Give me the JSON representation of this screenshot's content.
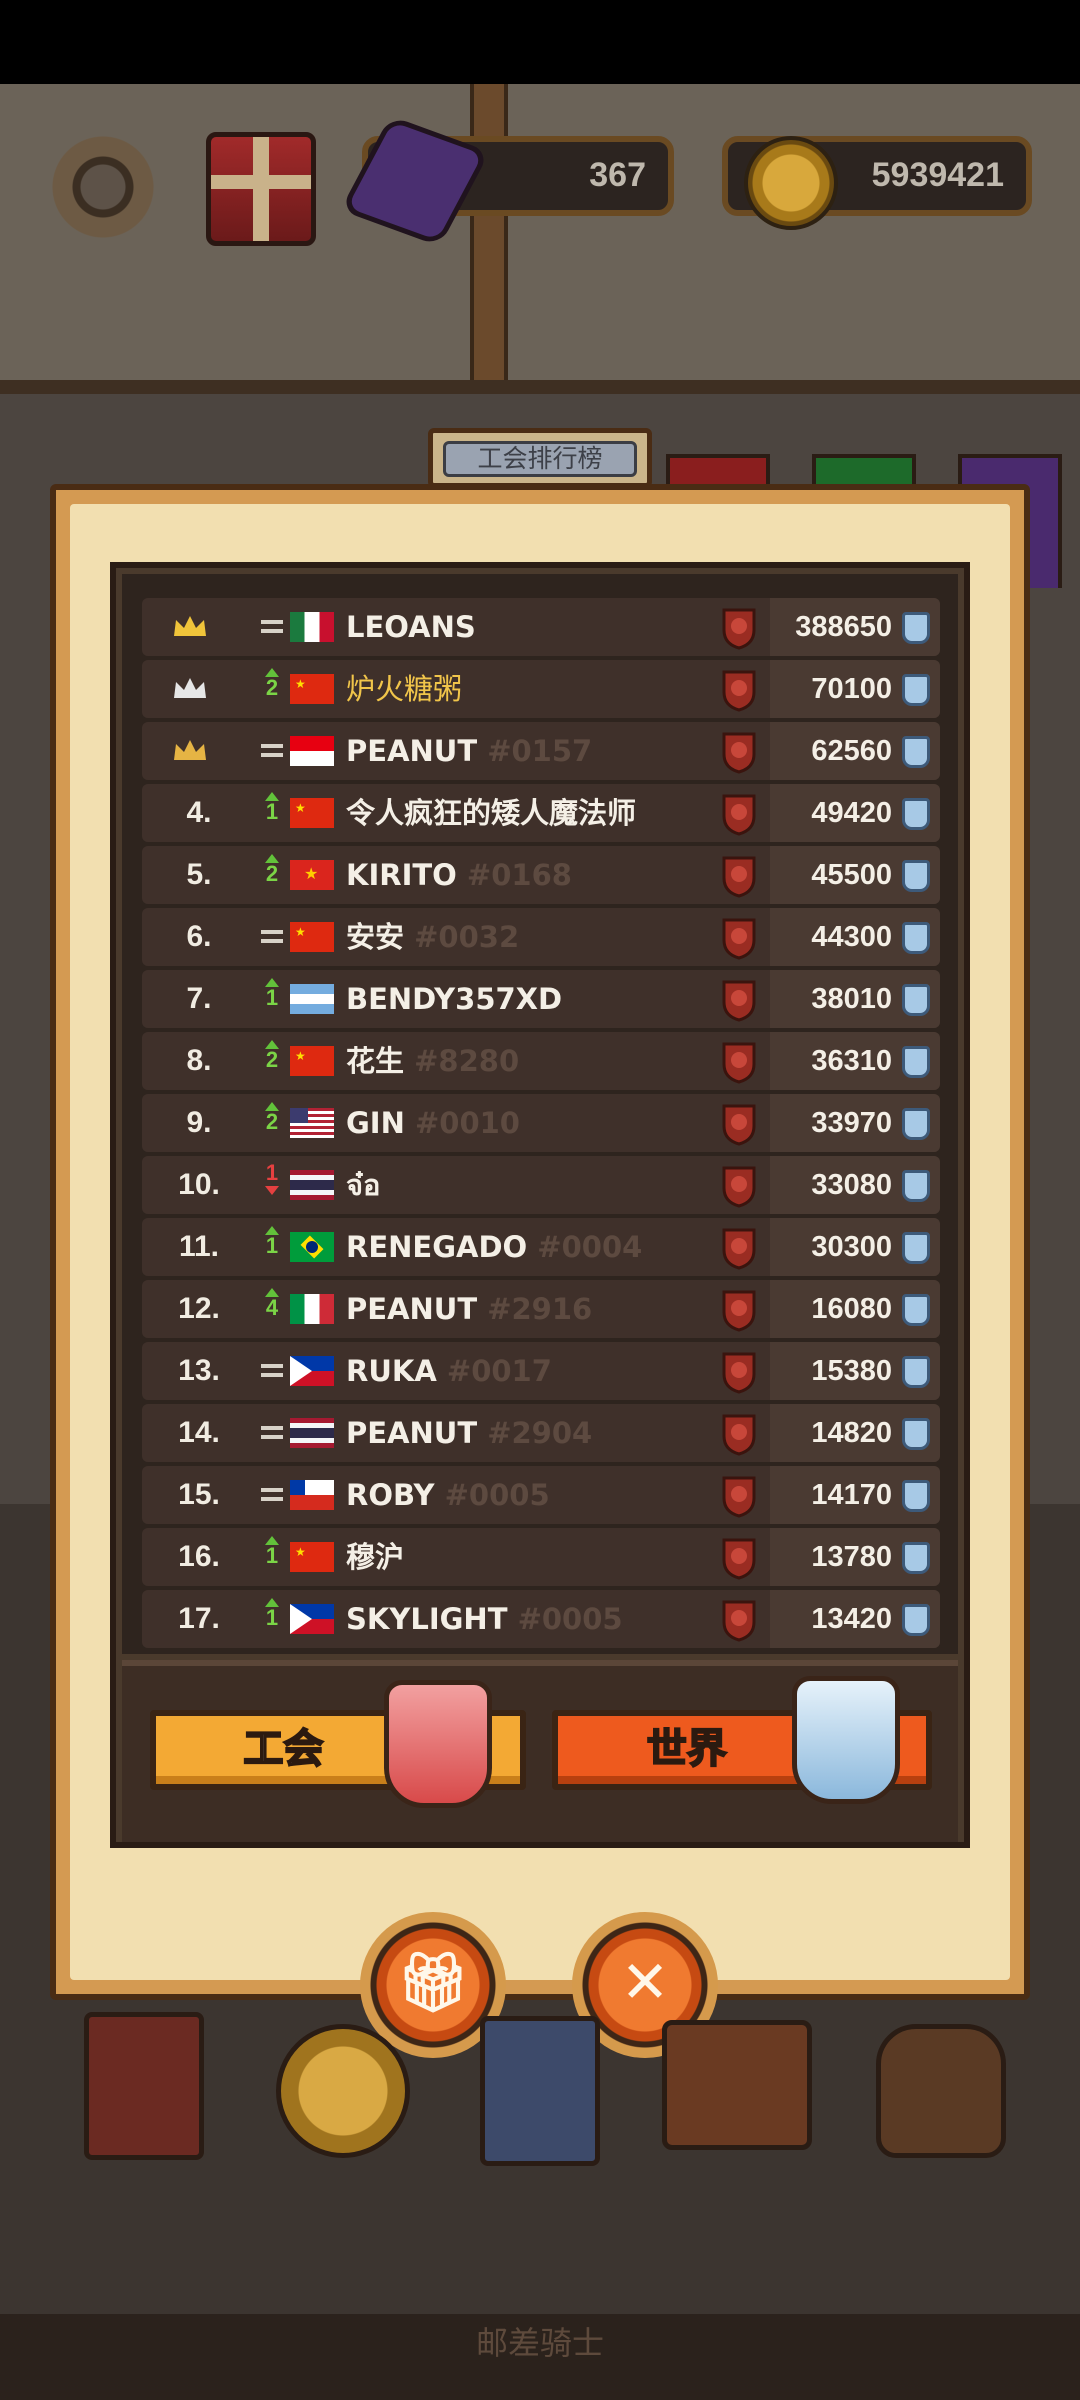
{
  "hud": {
    "gems": "367",
    "gold": "5939421"
  },
  "panel": {
    "title": "工会排行榜"
  },
  "rows": [
    {
      "rank": "",
      "crown": "gold",
      "change": "=",
      "name": "LEOANS",
      "tag": "",
      "score": "388650",
      "flag": "mexico"
    },
    {
      "rank": "",
      "crown": "silver",
      "change": "up",
      "delta": "2",
      "name": "炉火糖粥",
      "tag": "",
      "score": "70100",
      "flag": "china",
      "highlight": true
    },
    {
      "rank": "",
      "crown": "bronze",
      "change": "=",
      "name": "PEANUT",
      "tag": "#0157",
      "score": "62560",
      "flag": "indonesia"
    },
    {
      "rank": "4.",
      "change": "up",
      "delta": "1",
      "name": "令人疯狂的矮人魔法师",
      "tag": "",
      "score": "49420",
      "flag": "china"
    },
    {
      "rank": "5.",
      "change": "up",
      "delta": "2",
      "name": "KIRITO",
      "tag": "#0168",
      "score": "45500",
      "flag": "vietnam"
    },
    {
      "rank": "6.",
      "change": "=",
      "name": "安安",
      "tag": "#0032",
      "score": "44300",
      "flag": "china"
    },
    {
      "rank": "7.",
      "change": "up",
      "delta": "1",
      "name": "BENDY357XD",
      "tag": "",
      "score": "38010",
      "flag": "argentina"
    },
    {
      "rank": "8.",
      "change": "up",
      "delta": "2",
      "name": "花生",
      "tag": "#8280",
      "score": "36310",
      "flag": "china"
    },
    {
      "rank": "9.",
      "change": "up",
      "delta": "2",
      "name": "GIN",
      "tag": "#0010",
      "score": "33970",
      "flag": "usa"
    },
    {
      "rank": "10.",
      "change": "down",
      "delta": "1",
      "name": "จ๋อ",
      "tag": "",
      "score": "33080",
      "flag": "thailand"
    },
    {
      "rank": "11.",
      "change": "up",
      "delta": "1",
      "name": "RENEGADO",
      "tag": "#0004",
      "score": "30300",
      "flag": "brazil"
    },
    {
      "rank": "12.",
      "change": "up",
      "delta": "4",
      "name": "PEANUT",
      "tag": "#2916",
      "score": "16080",
      "flag": "italy"
    },
    {
      "rank": "13.",
      "change": "=",
      "name": "RUKA",
      "tag": "#0017",
      "score": "15380",
      "flag": "philippines"
    },
    {
      "rank": "14.",
      "change": "=",
      "name": "PEANUT",
      "tag": "#2904",
      "score": "14820",
      "flag": "thailand"
    },
    {
      "rank": "15.",
      "change": "=",
      "name": "ROBY",
      "tag": "#0005",
      "score": "14170",
      "flag": "chile"
    },
    {
      "rank": "16.",
      "change": "up",
      "delta": "1",
      "name": "穆沪",
      "tag": "",
      "score": "13780",
      "flag": "china"
    },
    {
      "rank": "17.",
      "change": "up",
      "delta": "1",
      "name": "SKYLIGHT",
      "tag": "#0005",
      "score": "13420",
      "flag": "philippines"
    }
  ],
  "toggle": {
    "guild": "工会",
    "world": "世界"
  },
  "footer": "邮差骑士"
}
